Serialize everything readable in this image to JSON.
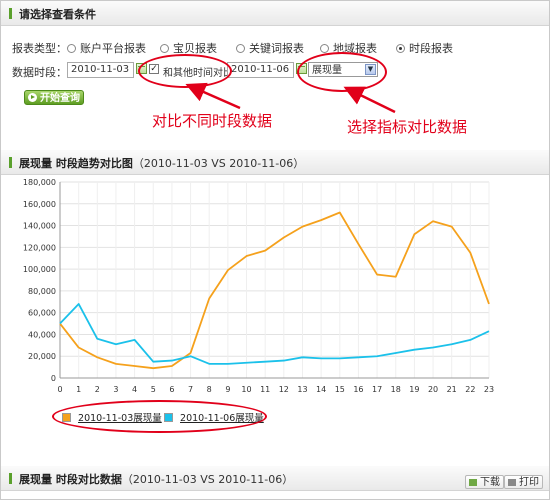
{
  "criteria_panel": {
    "title": "请选择查看条件",
    "report_type_label": "报表类型：",
    "report_types": [
      {
        "label": "账户平台报表",
        "selected": false
      },
      {
        "label": "宝贝报表",
        "selected": false
      },
      {
        "label": "关键词报表",
        "selected": false
      },
      {
        "label": "地域报表",
        "selected": false
      },
      {
        "label": "时段报表",
        "selected": true
      }
    ],
    "date_range_label": "数据时段：",
    "date_value": "2010-11-03",
    "compare_checkbox_label": "和其他时间对比",
    "compare_checked": true,
    "compare_date_value": "2010-11-06",
    "metric_selected": "展现量",
    "start_query_label": "开始查询"
  },
  "annotations": {
    "compare_dates": "对比不同时段数据",
    "select_metric": "选择指标对比数据"
  },
  "trend_panel": {
    "title": "展现量 时段趋势对比图",
    "subtitle": "（2010-11-03 VS 2010-11-06）"
  },
  "data_panel": {
    "title": "展现量 时段对比数据",
    "subtitle": "（2010-11-03 VS 2010-11-06）",
    "download_label": "下载",
    "print_label": "打印"
  },
  "colors": {
    "series_1": "#f5a11c",
    "series_2": "#1bc1ea",
    "annotation": "#e1001a",
    "accent_green": "#5aa02c"
  },
  "chart_data": {
    "type": "line",
    "x": [
      0,
      1,
      2,
      3,
      4,
      5,
      6,
      7,
      8,
      9,
      10,
      11,
      12,
      13,
      14,
      15,
      16,
      17,
      18,
      19,
      20,
      21,
      22,
      23
    ],
    "xlim": [
      0,
      23
    ],
    "ylim": [
      0,
      180000
    ],
    "yticks": [
      0,
      20000,
      40000,
      60000,
      80000,
      100000,
      120000,
      140000,
      160000,
      180000
    ],
    "ytick_labels": [
      "0",
      "20,000",
      "40,000",
      "60,000",
      "80,000",
      "100,000",
      "120,000",
      "140,000",
      "160,000",
      "180,000"
    ],
    "grid": true,
    "series": [
      {
        "name": "2010-11-03展现量",
        "color": "#f5a11c",
        "values": [
          50000,
          28000,
          19000,
          13000,
          11000,
          9000,
          11000,
          23000,
          73000,
          99000,
          112000,
          117000,
          129000,
          139000,
          145000,
          152000,
          123000,
          95000,
          93000,
          132000,
          144000,
          139000,
          115000,
          68000
        ]
      },
      {
        "name": "2010-11-06展现量",
        "color": "#1bc1ea",
        "values": [
          50000,
          68000,
          36000,
          31000,
          35000,
          15000,
          16000,
          20000,
          13000,
          13000,
          14000,
          15000,
          16000,
          19000,
          18000,
          18000,
          19000,
          20000,
          23000,
          26000,
          28000,
          31000,
          35000,
          43000
        ]
      }
    ]
  }
}
